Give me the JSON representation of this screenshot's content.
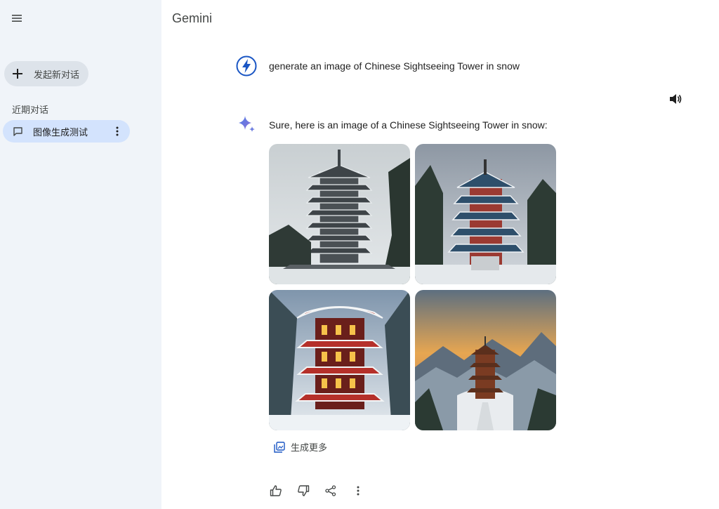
{
  "sidebar": {
    "new_chat_label": "发起新对话",
    "recent_label": "近期对话",
    "items": [
      {
        "label": "图像生成测试"
      }
    ]
  },
  "header": {
    "title": "Gemini"
  },
  "conversation": {
    "user_prompt": "generate an image of Chinese Sightseeing Tower in snow",
    "response_text": "Sure, here is an image of a Chinese Sightseeing Tower in snow:",
    "images": [
      {
        "name": "pagoda-snow-gray"
      },
      {
        "name": "pagoda-snow-forest"
      },
      {
        "name": "pagoda-snow-lanterns"
      },
      {
        "name": "pagoda-mountain-sunset"
      }
    ],
    "generate_more_label": "生成更多"
  },
  "colors": {
    "sidebar_bg": "#f0f4f9",
    "active_item_bg": "#d3e3fd",
    "accent_blue": "#1a73e8"
  },
  "icons": [
    "menu-icon",
    "plus-icon",
    "chat-icon",
    "more-vert-icon",
    "bolt-avatar-icon",
    "volume-icon",
    "gemini-sparkle-icon",
    "gallery-icon",
    "thumbs-up-icon",
    "thumbs-down-icon",
    "share-icon"
  ]
}
